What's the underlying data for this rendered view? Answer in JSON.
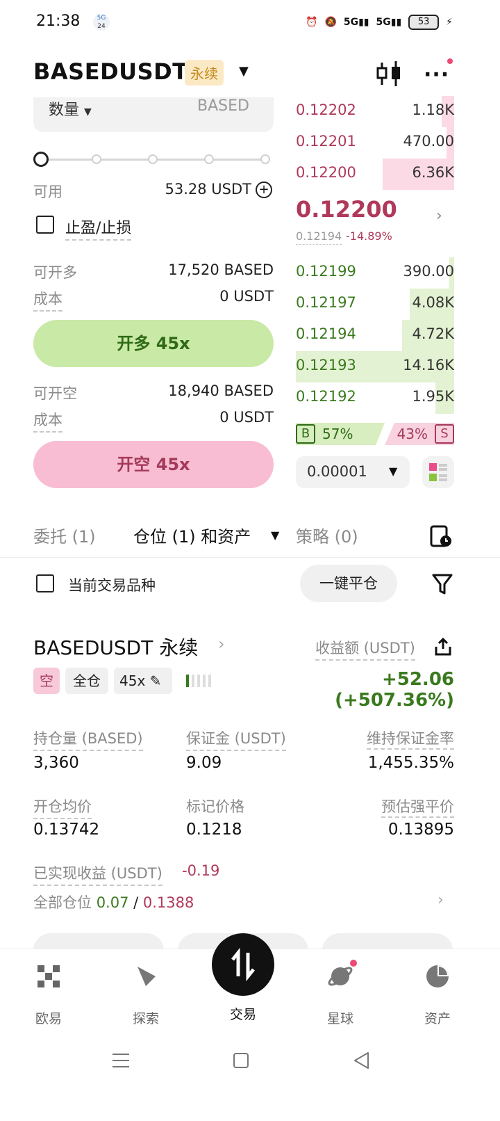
{
  "status": {
    "time": "21:38",
    "badge": "24",
    "battery": "53"
  },
  "header": {
    "pair": "BASEDUSDT",
    "contract_type": "永续"
  },
  "order_form": {
    "qty_label": "数量",
    "qty_unit": "BASED",
    "slider_percent": 0,
    "available_label": "可用",
    "available_value": "53.28 USDT",
    "tpsl_label": "止盈/止损",
    "long_max_label": "可开多",
    "long_max_value": "17,520 BASED",
    "long_cost_label": "成本",
    "long_cost_value": "0 USDT",
    "long_button": "开多 45x",
    "short_max_label": "可开空",
    "short_max_value": "18,940 BASED",
    "short_cost_label": "成本",
    "short_cost_value": "0 USDT",
    "short_button": "开空 45x"
  },
  "order_book": {
    "asks": [
      {
        "price": "0.12202",
        "size": "1.18K",
        "depth": 0.08
      },
      {
        "price": "0.12201",
        "size": "470.00",
        "depth": 0.05
      },
      {
        "price": "0.12200",
        "size": "6.36K",
        "depth": 0.45
      }
    ],
    "last_price": "0.12200",
    "mark_price": "0.12194",
    "change": "-14.89%",
    "bids": [
      {
        "price": "0.12199",
        "size": "390.00",
        "depth": 0.03
      },
      {
        "price": "0.12197",
        "size": "4.08K",
        "depth": 0.28
      },
      {
        "price": "0.12194",
        "size": "4.72K",
        "depth": 0.33
      },
      {
        "price": "0.12193",
        "size": "14.16K",
        "depth": 1.0
      },
      {
        "price": "0.12192",
        "size": "1.95K",
        "depth": 0.12
      }
    ],
    "buy_tag": "B",
    "buy_pct": "57%",
    "sell_pct": "43%",
    "sell_tag": "S",
    "precision": "0.00001"
  },
  "tabs": {
    "orders": "委托 (1)",
    "positions": "仓位 (1) 和资产",
    "strategy": "策略 (0)"
  },
  "filter": {
    "current_pair_label": "当前交易品种",
    "close_all": "一键平仓"
  },
  "position": {
    "title": "BASEDUSDT 永续",
    "pnl_label": "收益额 (USDT)",
    "side": "空",
    "margin_mode": "全仓",
    "leverage": "45x",
    "pnl_value": "+52.06 (+507.36%)",
    "size_label": "持仓量 (BASED)",
    "size_value": "3,360",
    "margin_label": "保证金 (USDT)",
    "margin_value": "9.09",
    "mmr_label": "维持保证金率",
    "mmr_value": "1,455.35%",
    "entry_label": "开仓均价",
    "entry_value": "0.13742",
    "mark_label": "标记价格",
    "mark_value": "0.1218",
    "liq_label": "预估强平价",
    "liq_value": "0.13895",
    "realized_label": "已实现收益 (USDT)",
    "realized_value": "-0.19",
    "all_pos_label": "全部仓位",
    "all_pos_green": "0.07",
    "all_pos_sep": " / ",
    "all_pos_red": "0.1388"
  },
  "nav": {
    "home": "欧易",
    "explore": "探索",
    "trade": "交易",
    "planet": "星球",
    "assets": "资产"
  }
}
